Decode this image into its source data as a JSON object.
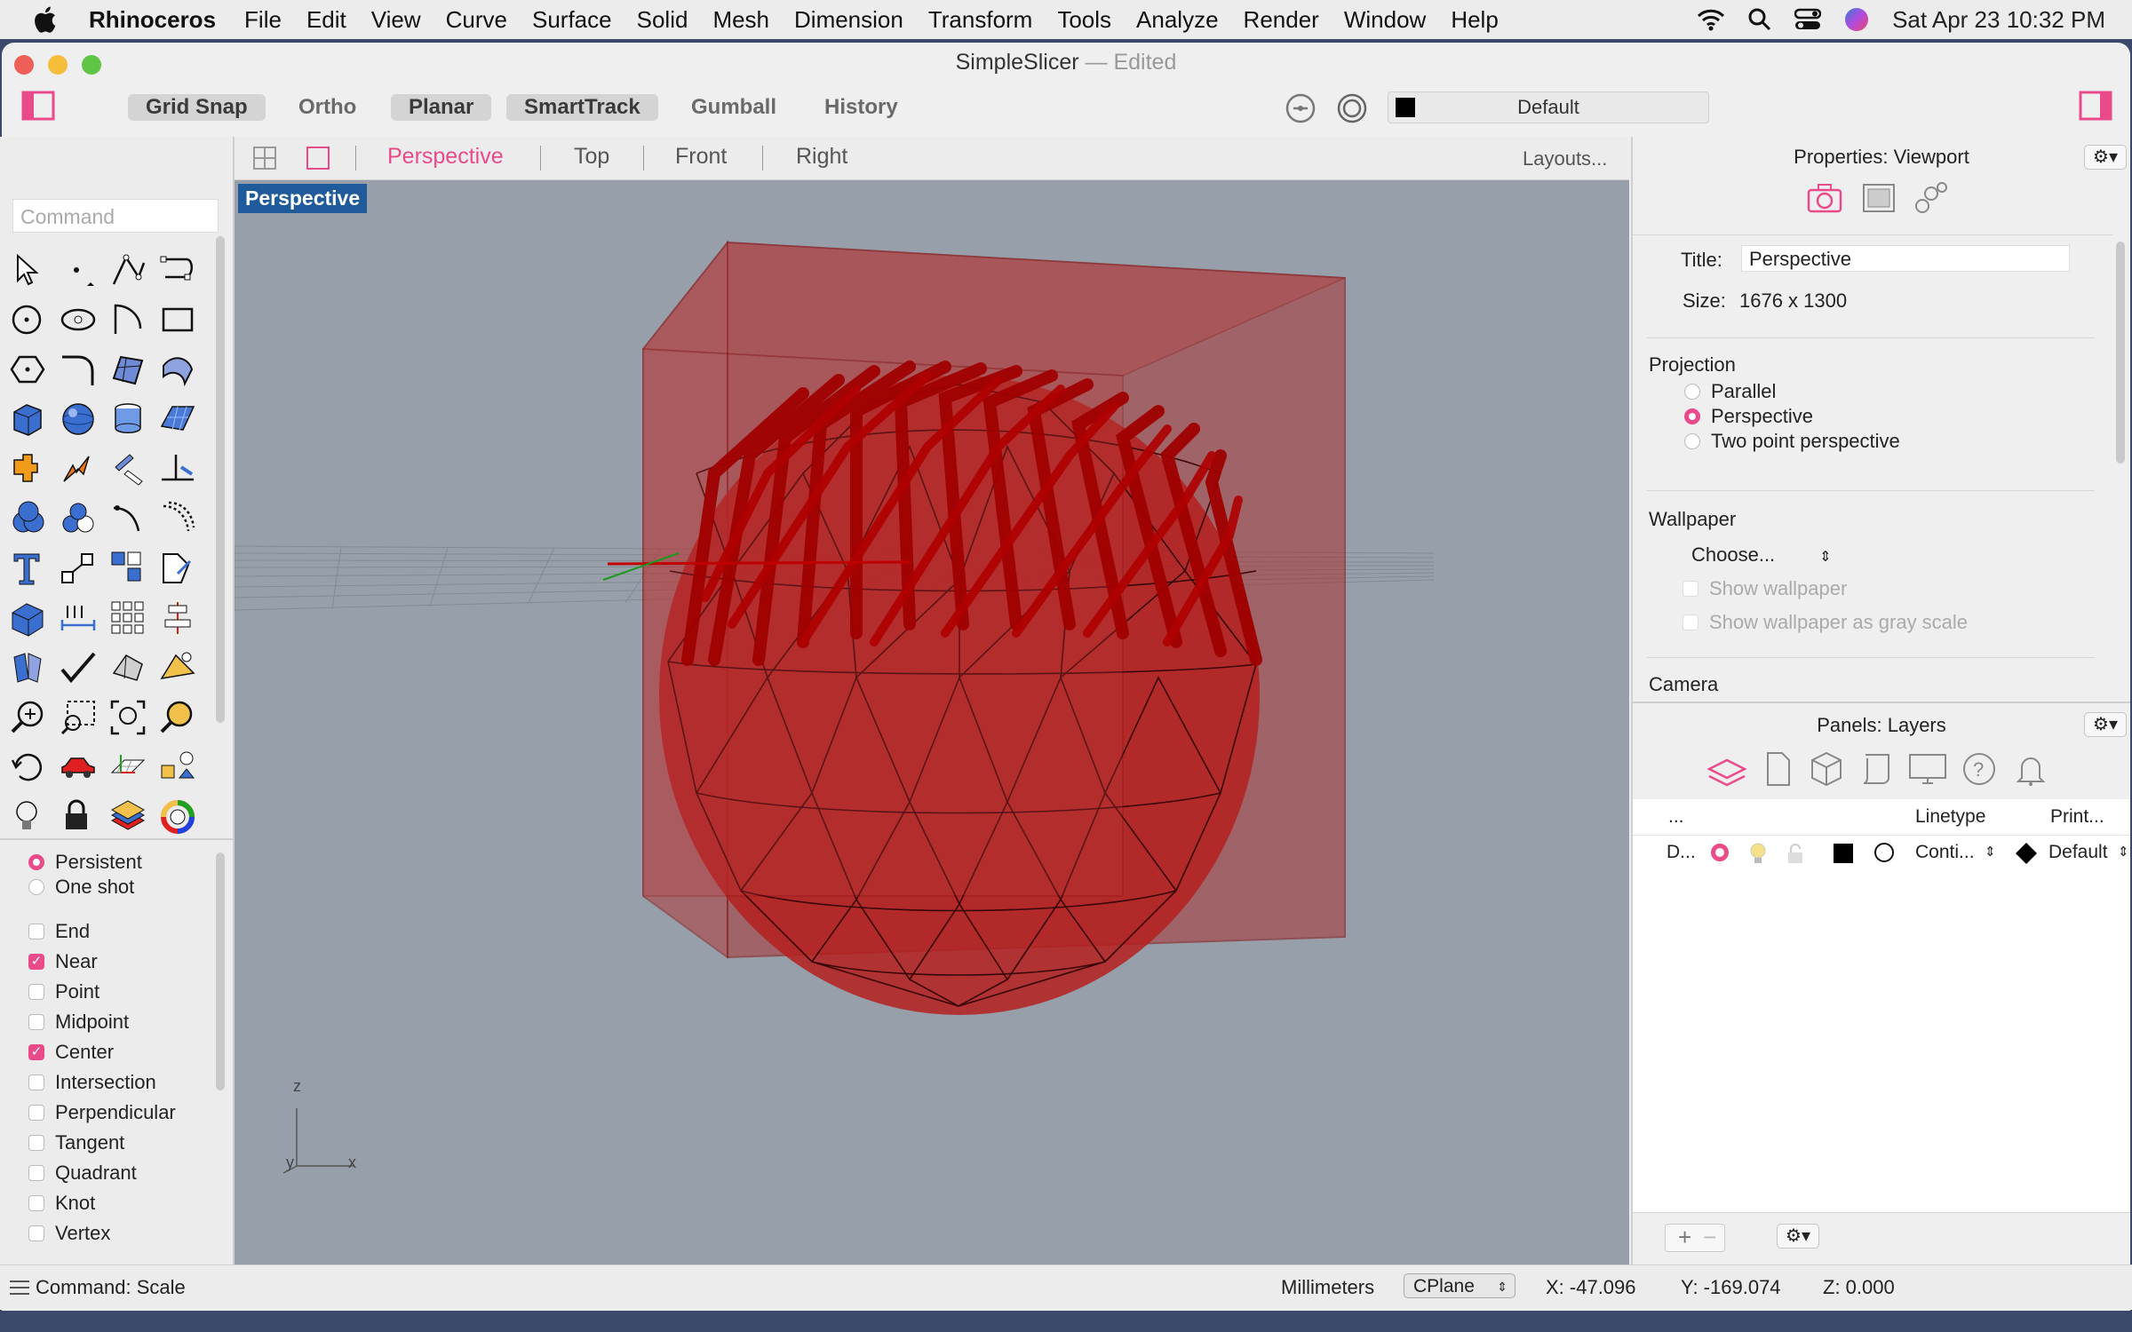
{
  "menubar": {
    "app": "Rhinoceros",
    "items": [
      "File",
      "Edit",
      "View",
      "Curve",
      "Surface",
      "Solid",
      "Mesh",
      "Dimension",
      "Transform",
      "Tools",
      "Analyze",
      "Render",
      "Window",
      "Help"
    ],
    "clock": "Sat Apr 23  10:32 PM"
  },
  "window": {
    "title": "SimpleSlicer",
    "edited": "Edited"
  },
  "toolbar": {
    "buttons": [
      {
        "label": "Grid Snap",
        "on": true
      },
      {
        "label": "Ortho",
        "on": false
      },
      {
        "label": "Planar",
        "on": true
      },
      {
        "label": "SmartTrack",
        "on": true
      },
      {
        "label": "Gumball",
        "on": false
      },
      {
        "label": "History",
        "on": false
      }
    ],
    "layer": "Default"
  },
  "command": {
    "placeholder": "Command"
  },
  "snaps": {
    "modes": [
      {
        "label": "Persistent",
        "on": true
      },
      {
        "label": "One shot",
        "on": false
      }
    ],
    "items": [
      {
        "label": "End",
        "on": false
      },
      {
        "label": "Near",
        "on": true
      },
      {
        "label": "Point",
        "on": false
      },
      {
        "label": "Midpoint",
        "on": false
      },
      {
        "label": "Center",
        "on": true
      },
      {
        "label": "Intersection",
        "on": false
      },
      {
        "label": "Perpendicular",
        "on": false
      },
      {
        "label": "Tangent",
        "on": false
      },
      {
        "label": "Quadrant",
        "on": false
      },
      {
        "label": "Knot",
        "on": false
      },
      {
        "label": "Vertex",
        "on": false
      }
    ]
  },
  "viewport_tabs": {
    "tabs": [
      "Perspective",
      "Top",
      "Front",
      "Right"
    ],
    "active": "Perspective",
    "layouts": "Layouts..."
  },
  "viewport": {
    "label": "Perspective",
    "axes": {
      "z": "z",
      "y": "y",
      "x": "x"
    }
  },
  "properties": {
    "header": "Properties: Viewport",
    "title_label": "Title:",
    "title_value": "Perspective",
    "size_label": "Size:",
    "size_value": "1676 x 1300",
    "projection_label": "Projection",
    "projection_options": [
      {
        "label": "Parallel",
        "on": false
      },
      {
        "label": "Perspective",
        "on": true
      },
      {
        "label": "Two point perspective",
        "on": false
      }
    ],
    "wallpaper_label": "Wallpaper",
    "wallpaper_choose": "Choose...",
    "show_wallpaper": "Show wallpaper",
    "show_gray": "Show wallpaper as gray scale",
    "camera_label": "Camera"
  },
  "layers": {
    "header": "Panels: Layers",
    "columns": [
      "...",
      "Linetype",
      "Print..."
    ],
    "row": {
      "name": "D...",
      "linetype": "Conti...",
      "print": "Default"
    }
  },
  "status": {
    "command": "Command: Scale",
    "units": "Millimeters",
    "cplane": "CPlane",
    "x": "X: -47.096",
    "y": "Y: -169.074",
    "z": "Z: 0.000"
  },
  "colors": {
    "accent": "#e84a8a",
    "model_red": "#b01a1a",
    "viewport_bg": "#97a0aa"
  }
}
